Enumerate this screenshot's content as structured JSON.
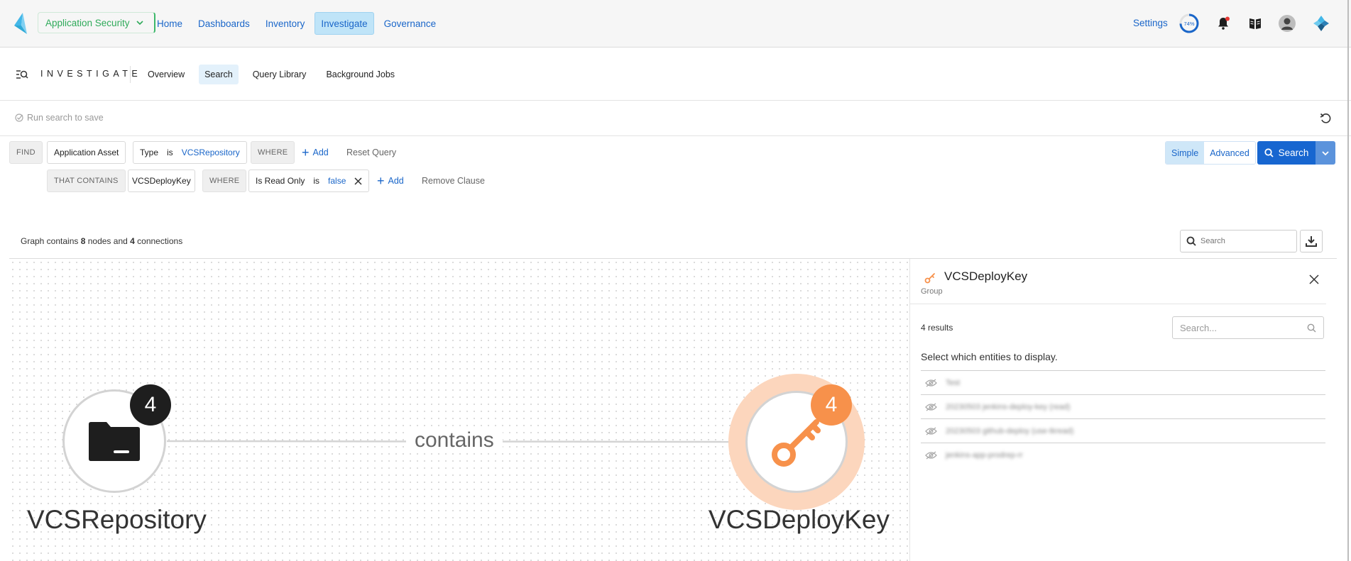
{
  "topnav": {
    "app_switch_label": "Application Security",
    "links": [
      "Home",
      "Dashboards",
      "Inventory",
      "Investigate",
      "Governance"
    ],
    "settings_label": "Settings",
    "progress_percent": "74%"
  },
  "subnav": {
    "title": "INVESTIGATE",
    "tabs": [
      "Overview",
      "Search",
      "Query Library",
      "Background Jobs"
    ]
  },
  "savebar": {
    "hint": "Run search to save"
  },
  "query": {
    "find_label": "FIND",
    "entity": "Application Asset",
    "filter1": {
      "field": "Type",
      "op": "is",
      "value": "VCSRepository"
    },
    "where_label": "WHERE",
    "add_label": "Add",
    "reset_label": "Reset Query",
    "contains_label": "THAT CONTAINS",
    "contains_entity": "VCSDeployKey",
    "filter2": {
      "field": "Is Read Only",
      "op": "is",
      "value": "false"
    },
    "remove_label": "Remove Clause"
  },
  "mode": {
    "simple": "Simple",
    "advanced": "Advanced"
  },
  "search_button": "Search",
  "graph": {
    "prefix": "Graph contains ",
    "nodes": "8",
    "middle": " nodes and ",
    "connections": "4",
    "suffix": " connections",
    "search_placeholder": "Search",
    "edge_label": "contains",
    "source": {
      "label": "VCSRepository",
      "count": "4",
      "icon": "folder-icon"
    },
    "target": {
      "label": "VCSDeployKey",
      "count": "4",
      "icon": "key-icon"
    }
  },
  "panel": {
    "title": "VCSDeployKey",
    "subtitle": "Group",
    "results": "4 results",
    "search_placeholder": "Search...",
    "select_hint": "Select which entities to display.",
    "entities": [
      "Test",
      "20230503 jenkins-deploy-key (read)",
      "20230503 github-deploy (use-tkread)",
      "jenkins-app-prodrep-rr"
    ]
  },
  "colors": {
    "accent": "#1766d0",
    "brand_green": "#2faa5a",
    "node_orange": "#f7914b",
    "node_dark": "#1e1e1e"
  }
}
